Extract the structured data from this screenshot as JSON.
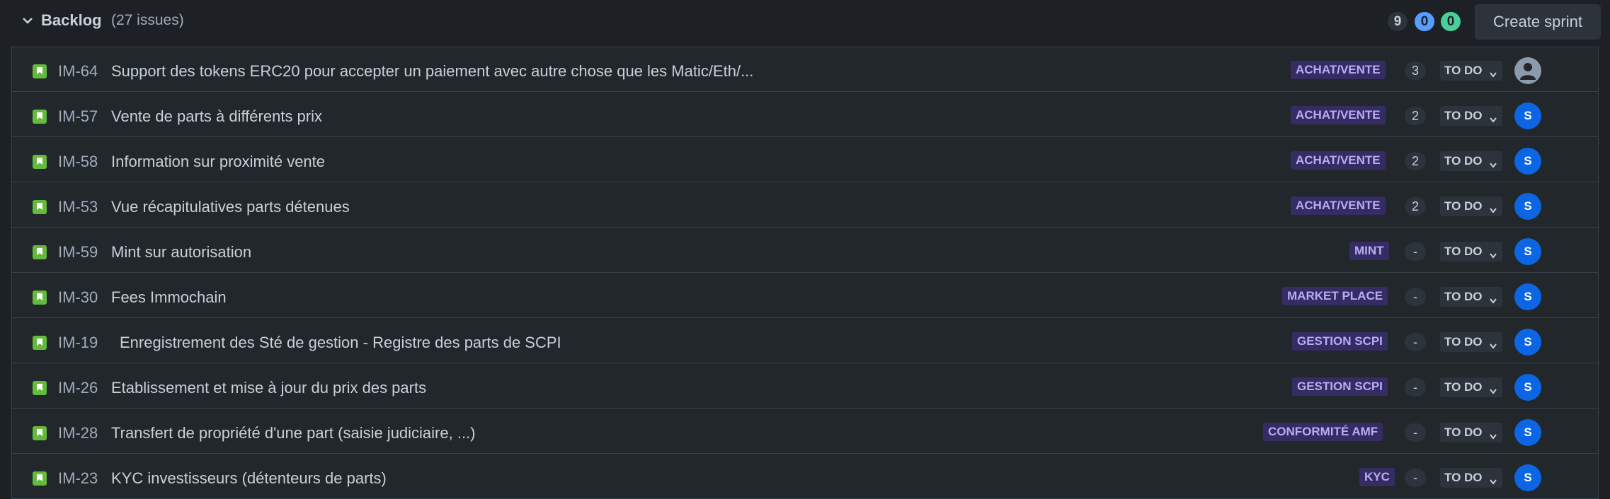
{
  "backlog": {
    "title": "Backlog",
    "count": "(27 issues)",
    "counts": {
      "todo": "9",
      "in_progress": "0",
      "done": "0"
    },
    "create_sprint_label": "Create sprint",
    "colors": {
      "todo": "#2c333a",
      "in_progress": "#579dff",
      "done": "#4bce97",
      "epic_bg": "#352c63",
      "epic_text": "#b8acf6",
      "story": "#63ba3c",
      "avatar": "#0c66e4"
    }
  },
  "issues": [
    {
      "key": "IM-64",
      "summary": "Support des tokens ERC20 pour accepter un paiement avec autre chose que les Matic/Eth/...",
      "epic": "ACHAT/VENTE",
      "points": "3",
      "status": "TO DO",
      "assignee": ""
    },
    {
      "key": "IM-57",
      "summary": "Vente de parts à différents prix",
      "epic": "ACHAT/VENTE",
      "points": "2",
      "status": "TO DO",
      "assignee": "S"
    },
    {
      "key": "IM-58",
      "summary": "Information sur proximité vente",
      "epic": "ACHAT/VENTE",
      "points": "2",
      "status": "TO DO",
      "assignee": "S"
    },
    {
      "key": "IM-53",
      "summary": "Vue récapitulatives parts détenues",
      "epic": "ACHAT/VENTE",
      "points": "2",
      "status": "TO DO",
      "assignee": "S"
    },
    {
      "key": "IM-59",
      "summary": "Mint sur autorisation",
      "epic": "MINT",
      "points": "-",
      "status": "TO DO",
      "assignee": "S"
    },
    {
      "key": "IM-30",
      "summary": "Fees Immochain",
      "epic": "MARKET PLACE",
      "points": "-",
      "status": "TO DO",
      "assignee": "S"
    },
    {
      "key": "IM-19",
      "summary": "Enregistrement des Sté de gestion - Registre des parts de SCPI",
      "epic": "GESTION SCPI",
      "points": "-",
      "status": "TO DO",
      "assignee": "S"
    },
    {
      "key": "IM-26",
      "summary": "Etablissement et mise à jour du prix des parts",
      "epic": "GESTION SCPI",
      "points": "-",
      "status": "TO DO",
      "assignee": "S"
    },
    {
      "key": "IM-28",
      "summary": "Transfert de propriété d'une part (saisie judiciaire, ...)",
      "epic": "CONFORMITÉ AMF",
      "points": "-",
      "status": "TO DO",
      "assignee": "S"
    },
    {
      "key": "IM-23",
      "summary": "KYC investisseurs (détenteurs de parts)",
      "epic": "KYC",
      "points": "-",
      "status": "TO DO",
      "assignee": "S"
    }
  ]
}
